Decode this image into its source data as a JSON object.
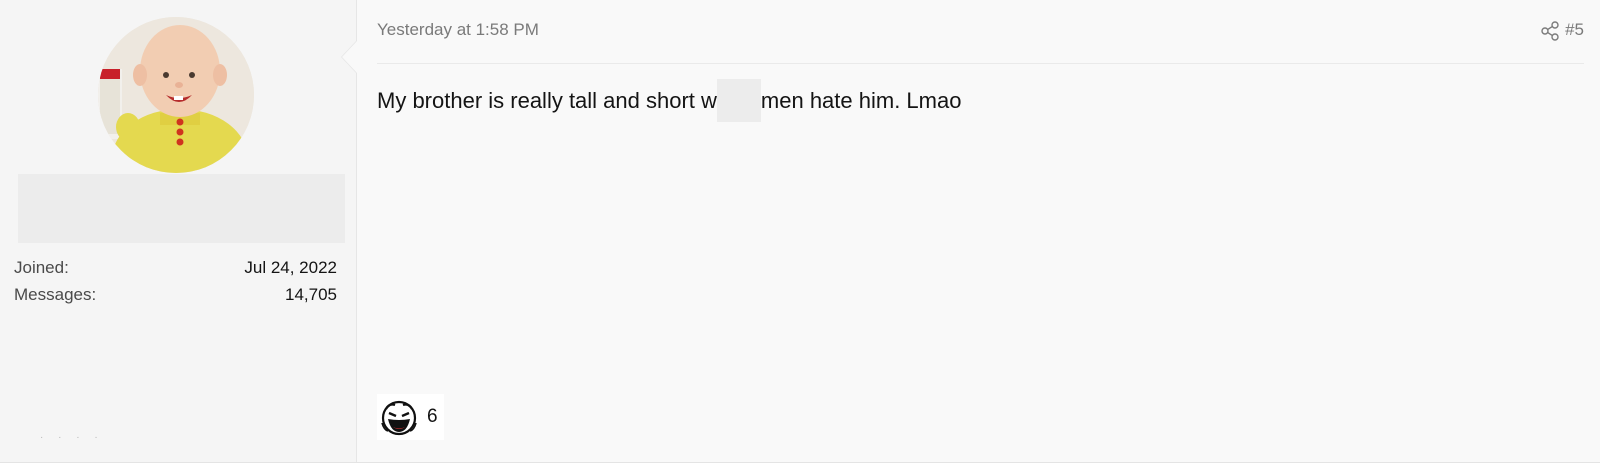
{
  "user": {
    "avatar_alt": "user avatar",
    "stats": [
      {
        "label": "Joined:",
        "value": "Jul 24, 2022"
      },
      {
        "label": "Messages:",
        "value": "14,705"
      }
    ]
  },
  "post": {
    "timestamp": "Yesterday at 1:58 PM",
    "number": "#5",
    "message_before": "My brother is really tall and short w",
    "message_after": "men hate him. Lmao",
    "reaction": {
      "icon": "laughing-face-icon",
      "count": "6"
    }
  },
  "colors": {
    "background": "#f9f9f9",
    "user_panel": "#f5f5f5",
    "muted_text": "#7a7a7a"
  }
}
